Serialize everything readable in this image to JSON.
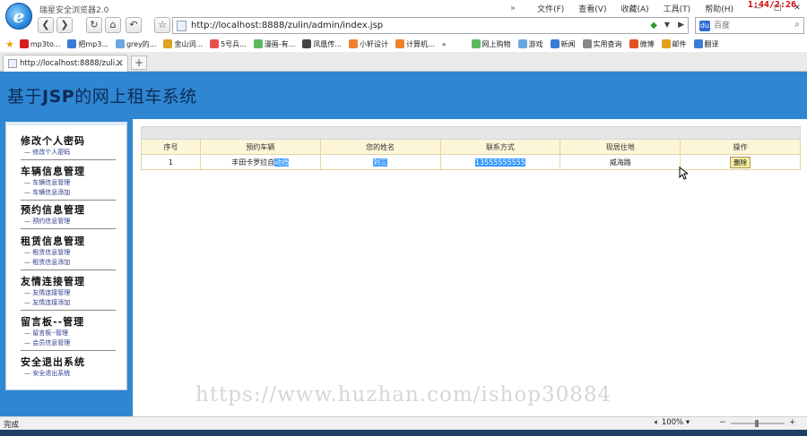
{
  "browser": {
    "app_title": "瑞星安全浏览器2.0",
    "clock": "1:44/2:26",
    "menu": [
      "文件(F)",
      "查看(V)",
      "收藏(A)",
      "工具(T)",
      "帮助(H)"
    ],
    "url": "http://localhost:8888/zulin/admin/index.jsp",
    "search_placeholder": "百度",
    "favorites": [
      {
        "label": "mp3to...",
        "color": "#d62020"
      },
      {
        "label": "把mp3...",
        "color": "#3a7bd5"
      },
      {
        "label": "grey的...",
        "color": "#6aa7e0"
      },
      {
        "label": "金山词...",
        "color": "#e0a020"
      },
      {
        "label": "5号兵...",
        "color": "#e85050"
      },
      {
        "label": "漫画-有...",
        "color": "#5cb85c"
      },
      {
        "label": "凤凰传...",
        "color": "#444444"
      },
      {
        "label": "小轩设计",
        "color": "#f08030"
      },
      {
        "label": "计算机...",
        "color": "#f08030"
      }
    ],
    "favorites_more": "»",
    "favorites_right": [
      {
        "label": "网上购物",
        "color": "#5cb85c"
      },
      {
        "label": "游戏",
        "color": "#6aa7e0"
      },
      {
        "label": "新闻",
        "color": "#3a7bd5"
      },
      {
        "label": "实用查询",
        "color": "#888888"
      },
      {
        "label": "微博",
        "color": "#e05020"
      },
      {
        "label": "邮件",
        "color": "#e0a020"
      },
      {
        "label": "翻译",
        "color": "#3a7bd5"
      }
    ],
    "tab_label": "http://localhost:8888/zuli...",
    "status_text": "完成",
    "zoom": "100%"
  },
  "header": {
    "title_prefix": "基于",
    "title_bold": "JSP",
    "title_suffix": "的网上租车系统"
  },
  "sidebar": {
    "groups": [
      {
        "title": "修改个人密码",
        "items": [
          "修改个人密码"
        ]
      },
      {
        "title": "车辆信息管理",
        "items": [
          "车辆信息管理",
          "车辆信息添加"
        ]
      },
      {
        "title": "预约信息管理",
        "items": [
          "预约信息管理"
        ]
      },
      {
        "title": "租赁信息管理",
        "items": [
          "租赁信息管理",
          "租赁信息添加"
        ]
      },
      {
        "title": "友情连接管理",
        "items": [
          "友情连接管理",
          "友情连接添加"
        ]
      },
      {
        "title": "留言板--管理",
        "items": [
          "留言板--管理",
          "会员信息管理"
        ]
      },
      {
        "title": "安全退出系统",
        "items": [
          "安全退出系统"
        ]
      }
    ]
  },
  "table": {
    "headers": [
      "序号",
      "预约车辆",
      "您的姓名",
      "联系方式",
      "现居住地",
      "操作"
    ],
    "rows": [
      {
        "index": "1",
        "car_plain": "丰田卡罗拉自",
        "car_selected": "动挡",
        "name": "刘三",
        "phone": "13555555555",
        "address": "威海路",
        "action": "删除"
      }
    ]
  },
  "watermark": "https://www.huzhan.com/ishop30884"
}
